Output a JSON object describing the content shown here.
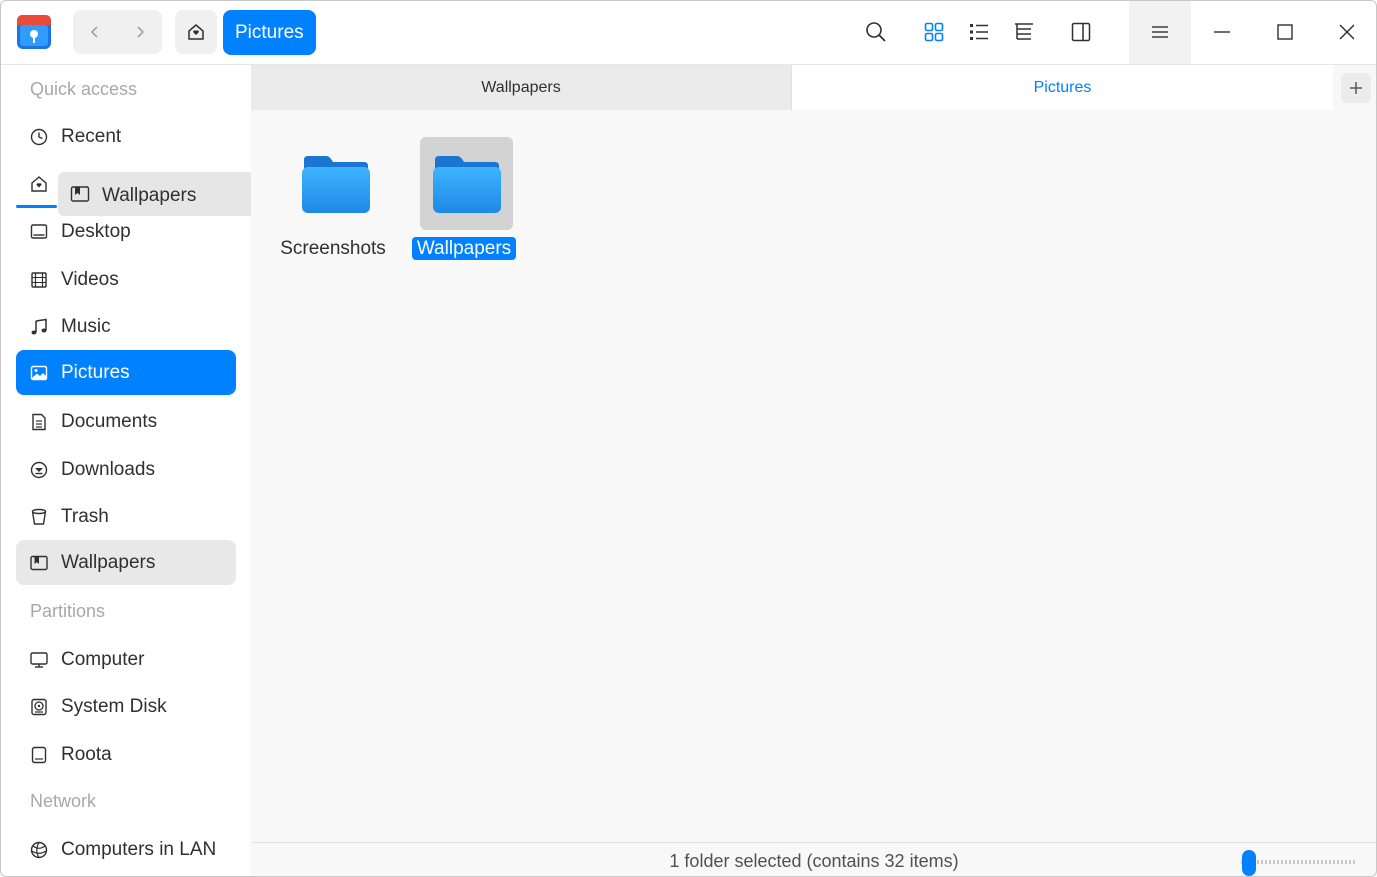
{
  "titlebar": {
    "breadcrumb": "Pictures",
    "icons": [
      "file-manager-logo",
      "back-arrow-icon",
      "forward-arrow-icon",
      "home-icon",
      "search-icon",
      "icon-view-icon",
      "list-view-icon",
      "tree-view-icon",
      "detail-pane-icon",
      "hamburger-menu-icon",
      "minimize-icon",
      "maximize-icon",
      "close-icon"
    ],
    "accent_color": "#0081ff"
  },
  "sidebar": {
    "quick_access_title": "Quick access",
    "partitions_title": "Partitions",
    "network_title": "Network",
    "items": [
      {
        "label": "Recent",
        "icon": "clock-icon"
      },
      {
        "label": "",
        "icon": "home-icon"
      },
      {
        "label": "Desktop",
        "icon": "desktop-icon"
      },
      {
        "label": "Videos",
        "icon": "film-icon"
      },
      {
        "label": "Music",
        "icon": "music-note-icon"
      },
      {
        "label": "Pictures",
        "icon": "picture-icon"
      },
      {
        "label": "Documents",
        "icon": "document-icon"
      },
      {
        "label": "Downloads",
        "icon": "download-icon"
      },
      {
        "label": "Trash",
        "icon": "trash-icon"
      },
      {
        "label": "Wallpapers",
        "icon": "bookmark-folder-icon"
      }
    ],
    "partitions": [
      {
        "label": "Computer",
        "icon": "computer-icon"
      },
      {
        "label": "System Disk",
        "icon": "disk-icon"
      },
      {
        "label": "Roota",
        "icon": "drive-icon"
      }
    ],
    "network": [
      {
        "label": "Computers in LAN",
        "icon": "network-icon"
      }
    ],
    "drag_ghost_label": "Wallpapers"
  },
  "tabs": [
    {
      "label": "Wallpapers",
      "active": false
    },
    {
      "label": "Pictures",
      "active": true
    }
  ],
  "files": [
    {
      "name": "Screenshots",
      "type": "folder",
      "selected": false
    },
    {
      "name": "Wallpapers",
      "type": "folder",
      "selected": true
    }
  ],
  "status": {
    "text": "1 folder selected (contains 32 items)"
  }
}
